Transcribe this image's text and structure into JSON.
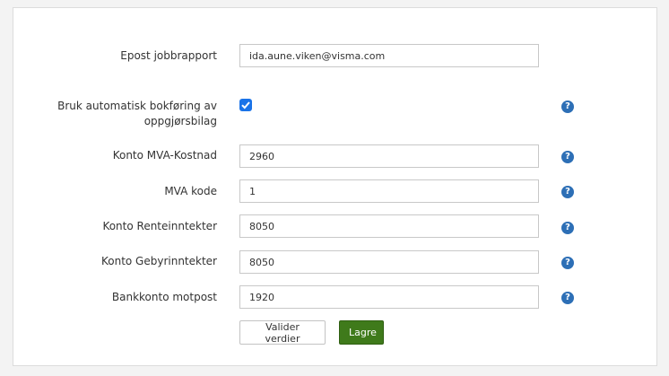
{
  "form": {
    "fields": [
      {
        "key": "epost",
        "label": "Epost jobbrapport",
        "value": "ida.aune.viken@visma.com"
      },
      {
        "key": "bokforing",
        "label_line1": "Bruk automatisk bokføring av",
        "label_line2": "oppgjørsbilag",
        "checked": true
      },
      {
        "key": "mva_kostnad",
        "label": "Konto MVA-Kostnad",
        "value": "2960"
      },
      {
        "key": "mva_kode",
        "label": "MVA kode",
        "value": "1"
      },
      {
        "key": "renteinntekter",
        "label": "Konto Renteinntekter",
        "value": "8050"
      },
      {
        "key": "gebyrinntekter",
        "label": "Konto Gebyrinntekter",
        "value": "8050"
      },
      {
        "key": "bankkonto",
        "label": "Bankkonto motpost",
        "value": "1920"
      }
    ],
    "help_glyph": "?",
    "buttons": {
      "validate_label": "Valider verdier",
      "save_label": "Lagre"
    }
  },
  "colors": {
    "primary_button": "#3f7a1b",
    "help_icon": "#2d6fb6",
    "checkbox": "#1a73e8"
  }
}
